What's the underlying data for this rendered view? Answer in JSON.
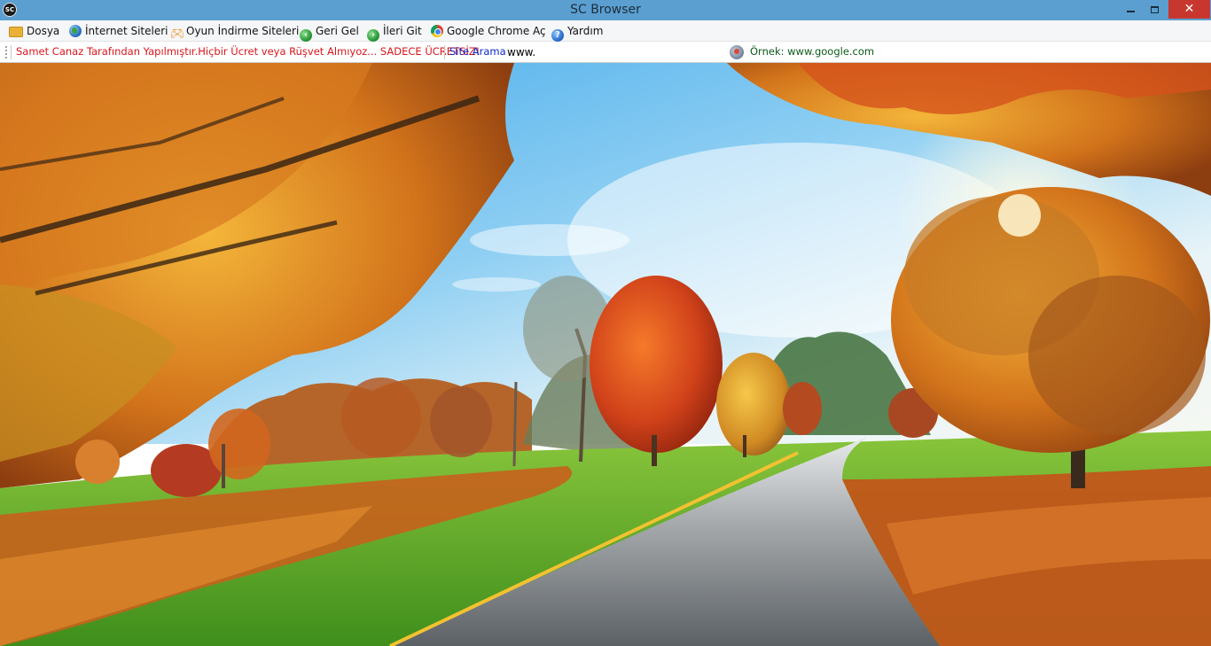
{
  "window": {
    "title": "SC Browser",
    "app_icon_text": "SC",
    "controls": {
      "minimize": "minimize",
      "maximize": "maximize",
      "close": "✕"
    }
  },
  "menu": {
    "items": [
      {
        "label": "Dosya",
        "icon": "folder-icon"
      },
      {
        "label": "İnternet Siteleri",
        "icon": "globe-icon"
      },
      {
        "label": "Oyun İndirme Siteleri",
        "icon": "gamepad-icon"
      },
      {
        "label": "Geri Gel",
        "icon": "back-arrow-icon"
      },
      {
        "label": "İleri Git",
        "icon": "forward-arrow-icon"
      },
      {
        "label": "Google Chrome Aç",
        "icon": "chrome-icon"
      },
      {
        "label": "Yardım",
        "icon": "help-icon"
      }
    ]
  },
  "addressbar": {
    "notice": "Samet Canaz Tarafından Yapılmıştır.Hiçbir Ücret veya Rüşvet Almıyoz... SADECE ÜCRETSİZ!",
    "site_search_label": "Site Arama",
    "url_value": "www.",
    "example_text": "Örnek: www.google.com"
  },
  "colors": {
    "titlebar": "#5a9fd0",
    "close_button": "#c7372f",
    "notice_text": "#d8161b",
    "site_search_text": "#0a27c9",
    "example_text": "#0d5a1a"
  },
  "content": {
    "type": "image",
    "subject": "autumn-road-landscape"
  }
}
